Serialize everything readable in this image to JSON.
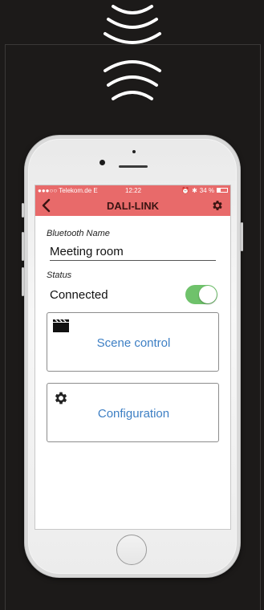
{
  "status_bar": {
    "carrier": "●●●○○ Telekom.de  E",
    "time": "12:22",
    "alarm": "⏰",
    "bluetooth": "✱",
    "battery_percent": "34 %",
    "battery_level": 0.34
  },
  "navbar": {
    "title": "DALI-LINK"
  },
  "form": {
    "bluetooth_name_label": "Bluetooth Name",
    "bluetooth_name_value": "Meeting room",
    "status_label": "Status",
    "status_value": "Connected",
    "connected_toggle_on": true
  },
  "cards": {
    "scene_control": "Scene control",
    "configuration": "Configuration"
  },
  "colors": {
    "header_bg": "#e86a6a",
    "toggle_on": "#6fc26b",
    "link_blue": "#3d7fc4",
    "page_bg": "#1c1a19"
  },
  "icons": {
    "signal": "wifi-signal-icon",
    "back": "chevron-left-icon",
    "settings": "gear-icon",
    "scene": "clapperboard-icon",
    "configuration": "gear-icon"
  }
}
